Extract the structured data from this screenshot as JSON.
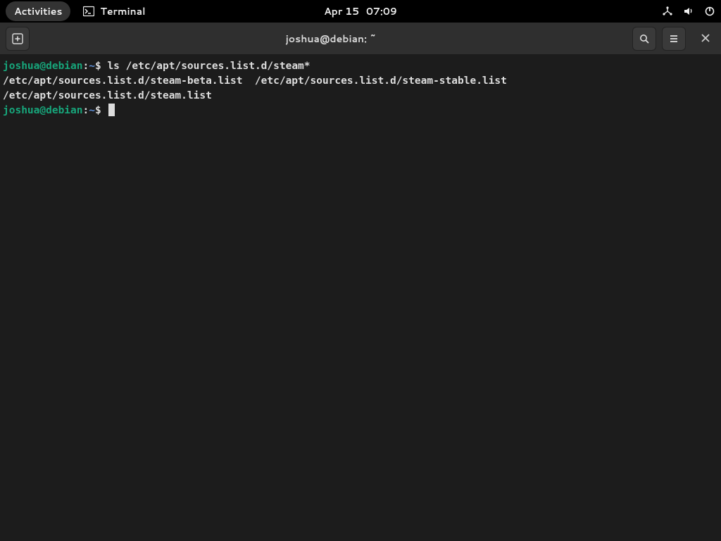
{
  "topbar": {
    "activities": "Activities",
    "app_name": "Terminal",
    "date": "Apr 15",
    "time": "07:09"
  },
  "window": {
    "title": "joshua@debian: ~"
  },
  "terminal": {
    "prompt": {
      "user_host": "joshua@debian",
      "colon": ":",
      "path": "~",
      "dollar": "$"
    },
    "lines": [
      {
        "type": "cmd",
        "text": "ls /etc/apt/sources.list.d/steam*"
      },
      {
        "type": "output",
        "text": "/etc/apt/sources.list.d/steam-beta.list  /etc/apt/sources.list.d/steam-stable.list"
      },
      {
        "type": "output",
        "text": "/etc/apt/sources.list.d/steam.list"
      },
      {
        "type": "prompt_only"
      }
    ]
  }
}
